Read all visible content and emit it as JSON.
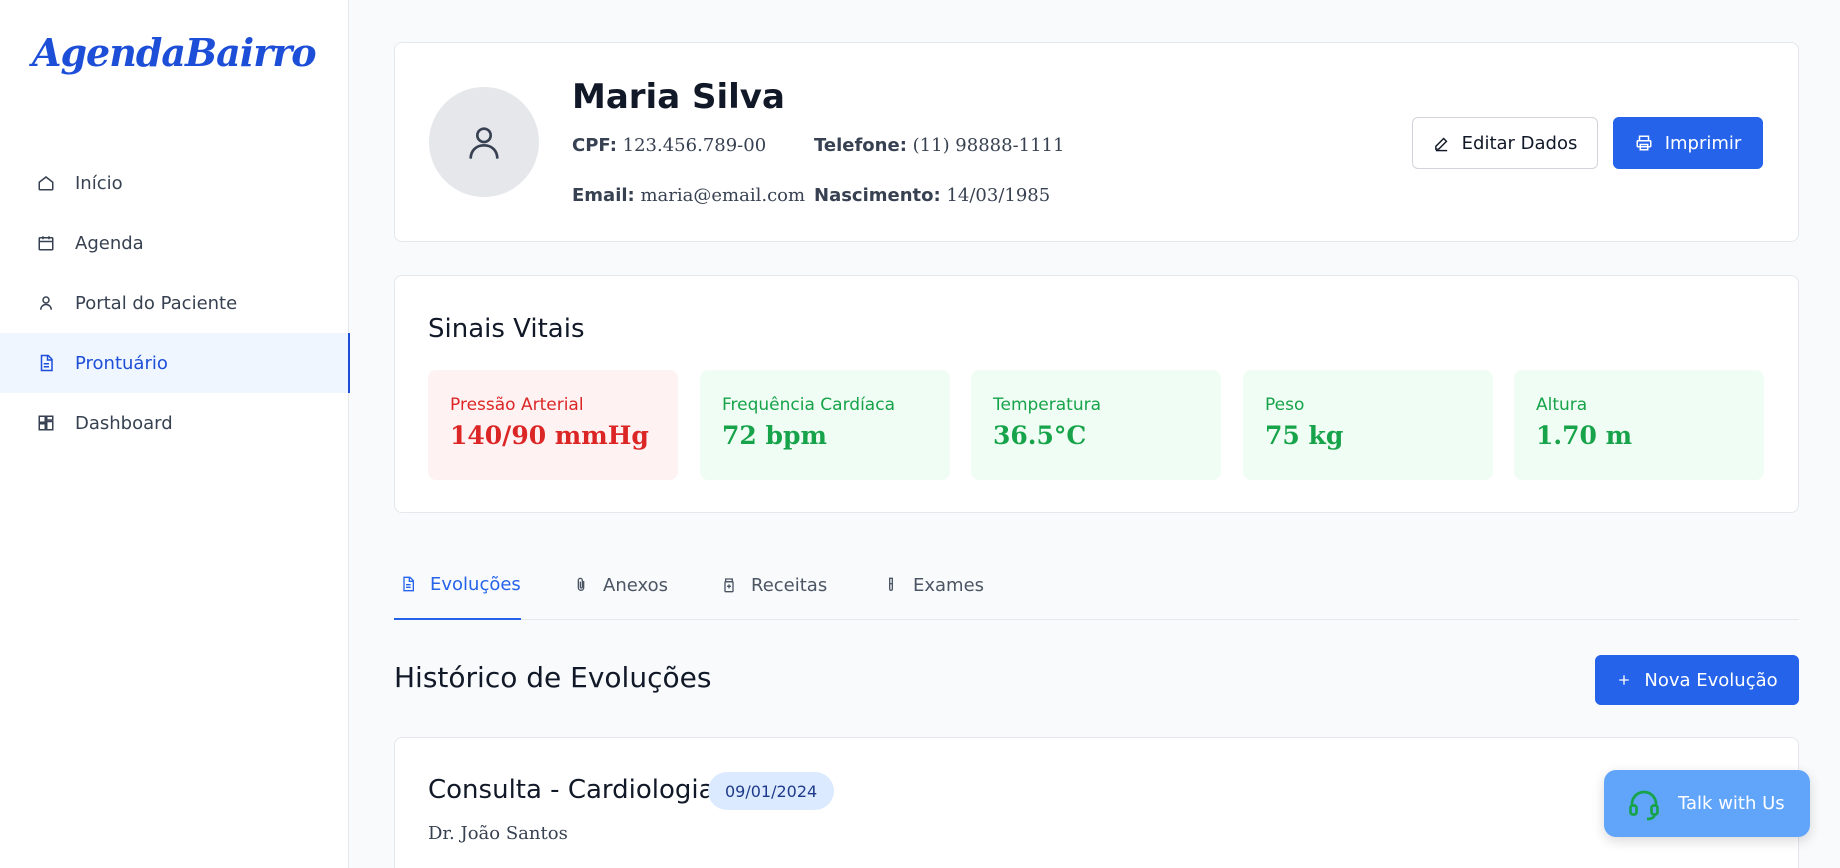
{
  "app": {
    "logo": "AgendaBairro"
  },
  "sidebar": {
    "items": [
      {
        "label": "Início",
        "icon": "home-icon"
      },
      {
        "label": "Agenda",
        "icon": "calendar-icon"
      },
      {
        "label": "Portal do Paciente",
        "icon": "user-icon"
      },
      {
        "label": "Prontuário",
        "icon": "document-icon",
        "active": true
      },
      {
        "label": "Dashboard",
        "icon": "dashboard-icon"
      }
    ]
  },
  "patient": {
    "name": "Maria Silva",
    "cpf_label": "CPF:",
    "cpf": "123.456.789-00",
    "phone_label": "Telefone:",
    "phone": "(11) 98888-1111",
    "email_label": "Email:",
    "email": "maria@email.com",
    "birth_label": "Nascimento:",
    "birth": "14/03/1985",
    "edit_label": "Editar Dados",
    "print_label": "Imprimir"
  },
  "vitals": {
    "title": "Sinais Vitais",
    "items": [
      {
        "label": "Pressão Arterial",
        "value": "140/90 mmHg",
        "status": "alert"
      },
      {
        "label": "Frequência Cardíaca",
        "value": "72 bpm",
        "status": "normal"
      },
      {
        "label": "Temperatura",
        "value": "36.5°C",
        "status": "normal"
      },
      {
        "label": "Peso",
        "value": "75 kg",
        "status": "normal"
      },
      {
        "label": "Altura",
        "value": "1.70 m",
        "status": "normal"
      }
    ]
  },
  "tabs": [
    {
      "label": "Evoluções",
      "icon": "document-icon",
      "active": true
    },
    {
      "label": "Anexos",
      "icon": "paperclip-icon"
    },
    {
      "label": "Receitas",
      "icon": "prescription-icon"
    },
    {
      "label": "Exames",
      "icon": "test-tube-icon"
    }
  ],
  "history": {
    "title": "Histórico de Evoluções",
    "new_label": "Nova Evolução",
    "entries": [
      {
        "title": "Consulta - Cardiologia",
        "date": "09/01/2024",
        "doctor": "Dr. João Santos"
      }
    ]
  },
  "chat": {
    "label": "Talk with Us"
  },
  "colors": {
    "primary": "#2563eb",
    "alert": "#dc2626",
    "normal": "#16a34a",
    "chat": "#60a5fa"
  }
}
